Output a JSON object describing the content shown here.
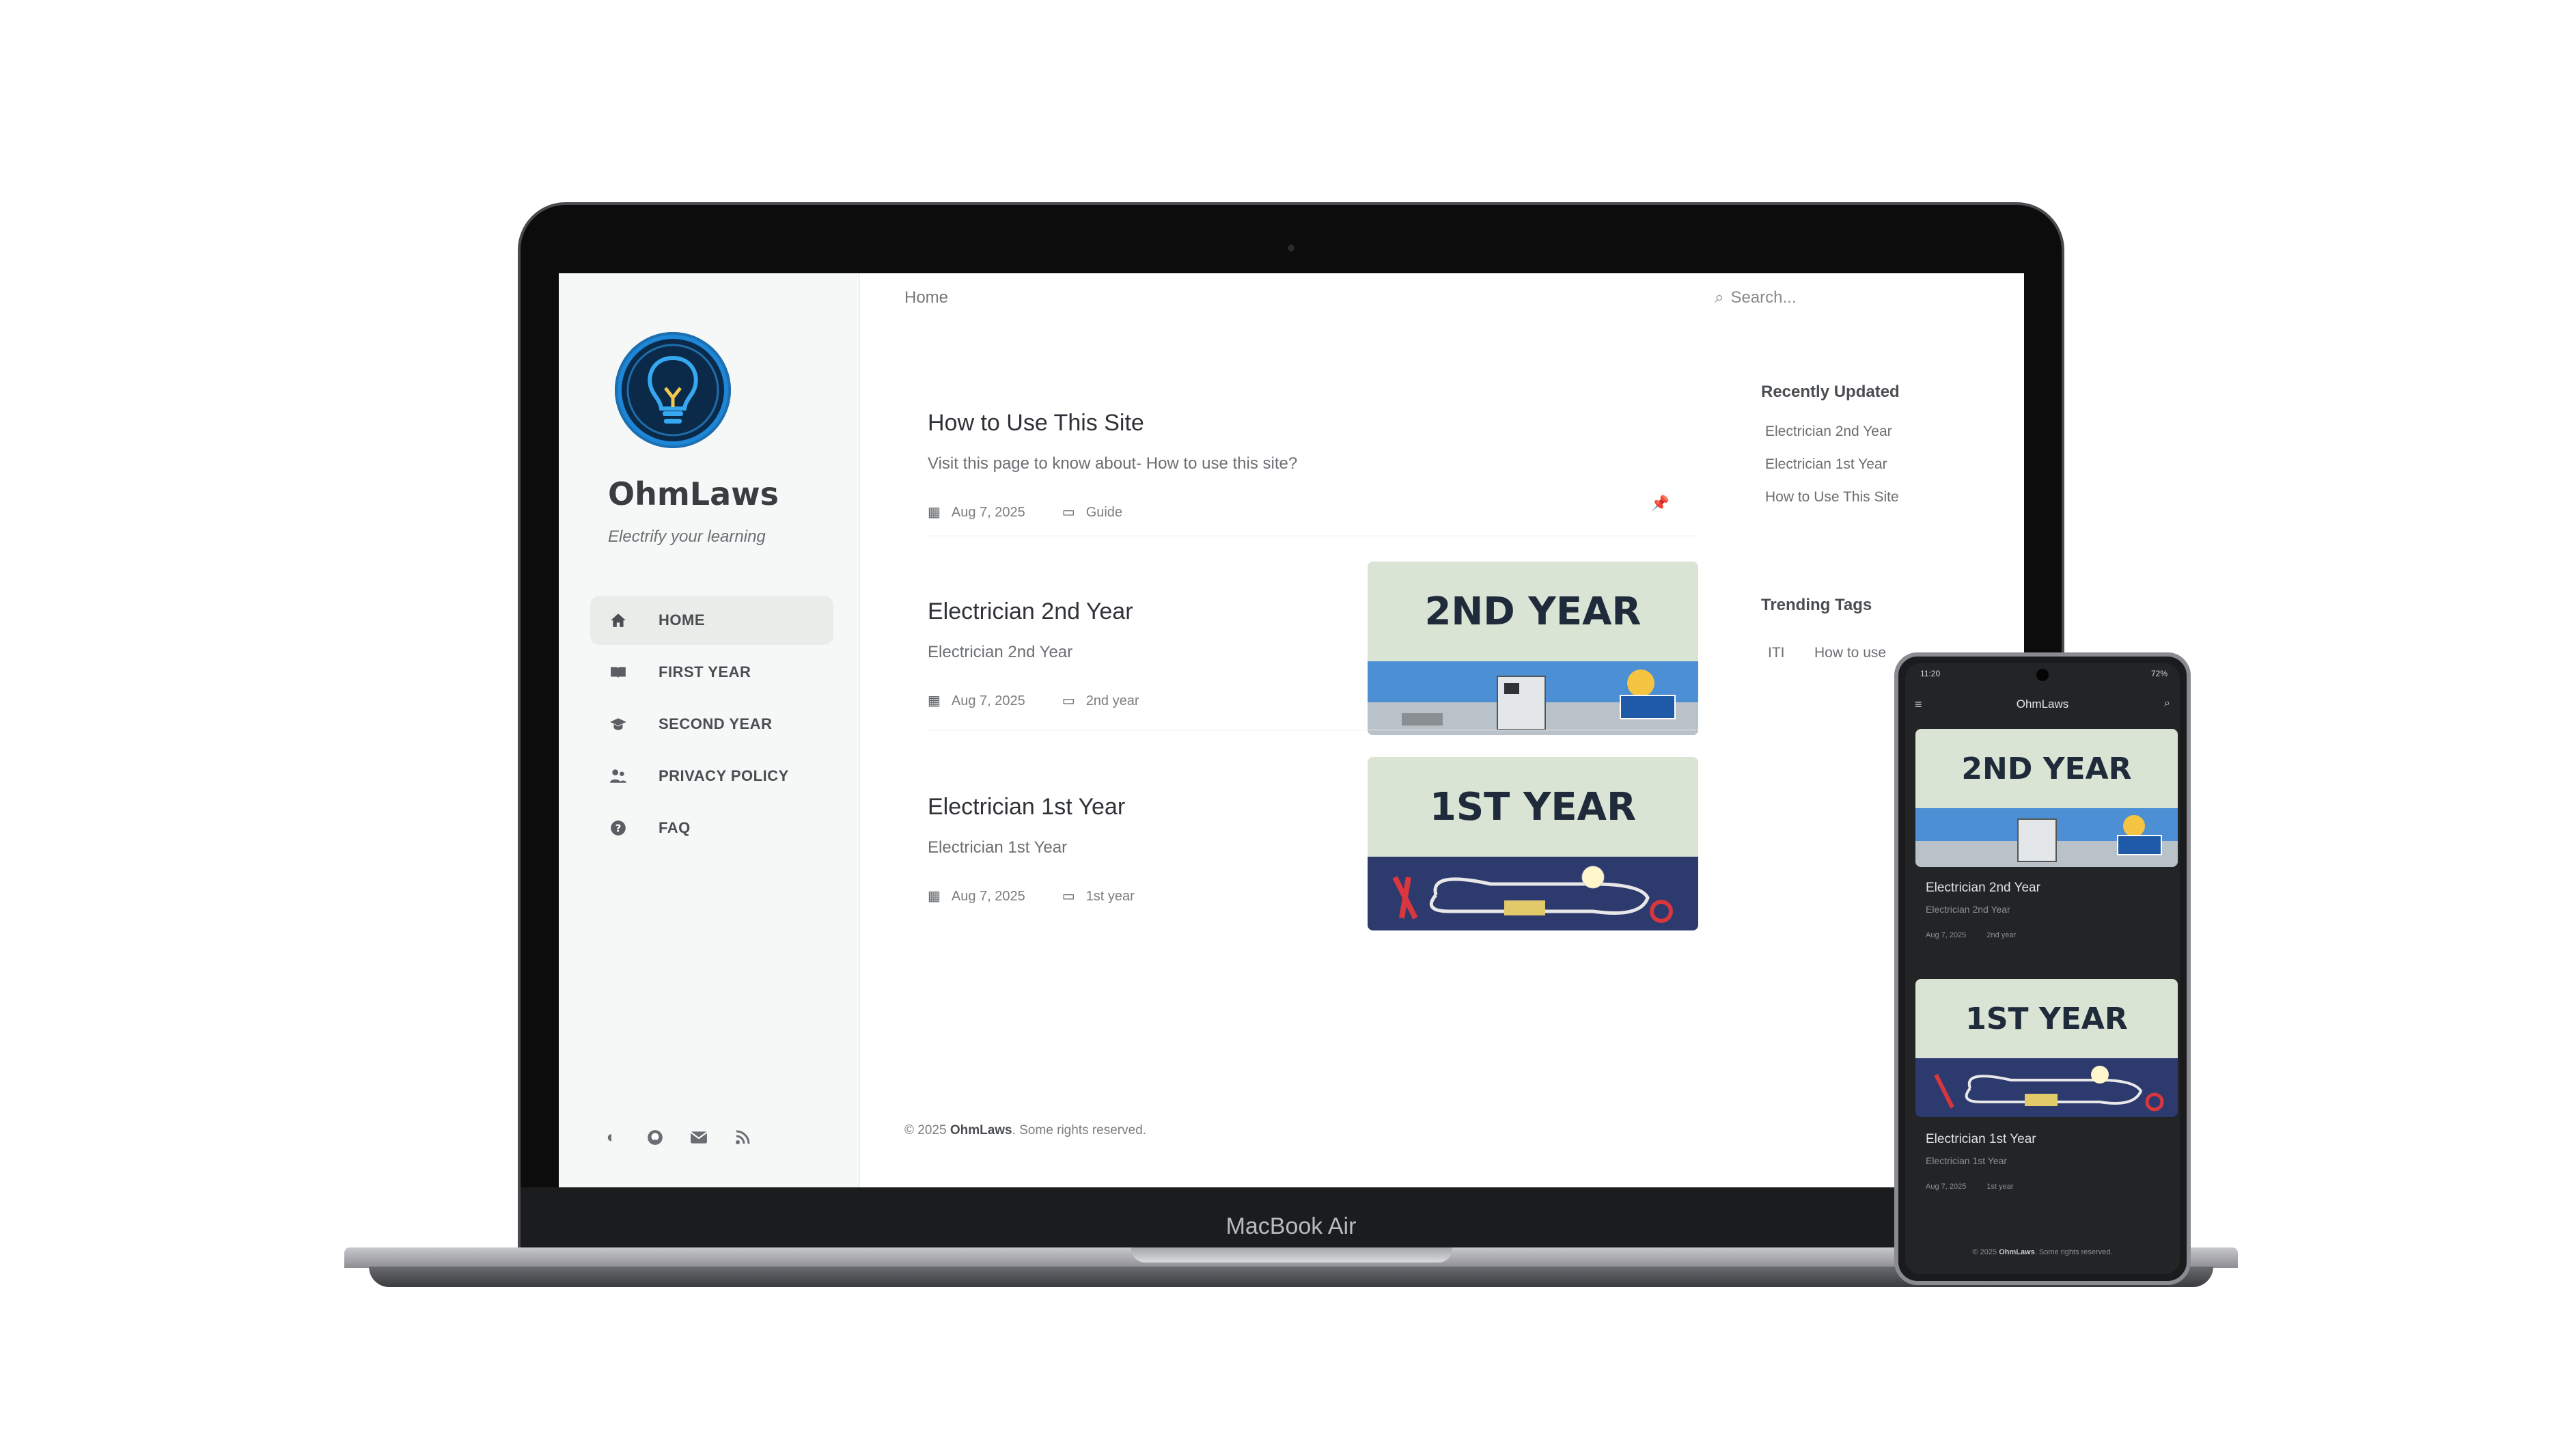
{
  "device_labels": {
    "laptop": "MacBook Air"
  },
  "site": {
    "title": "OhmLaws",
    "subtitle": "Electrify your learning"
  },
  "nav": [
    {
      "label": "HOME",
      "icon": "home-icon",
      "active": true
    },
    {
      "label": "FIRST YEAR",
      "icon": "book-icon",
      "active": false
    },
    {
      "label": "SECOND YEAR",
      "icon": "graduation-cap-icon",
      "active": false
    },
    {
      "label": "PRIVACY POLICY",
      "icon": "users-icon",
      "active": false
    },
    {
      "label": "FAQ",
      "icon": "question-circle-icon",
      "active": false
    }
  ],
  "breadcrumb": "Home",
  "search": {
    "placeholder": "Search..."
  },
  "posts": [
    {
      "title": "How to Use This Site",
      "description": "Visit this page to know about- How to use this site?",
      "date": "Aug 7, 2025",
      "category": "Guide",
      "pinned": true
    },
    {
      "title": "Electrician 2nd Year",
      "description": "Electrician 2nd Year",
      "date": "Aug 7, 2025",
      "category": "2nd year",
      "image_text": "2ND YEAR"
    },
    {
      "title": "Electrician 1st Year",
      "description": "Electrician 1st Year",
      "date": "Aug 7, 2025",
      "category": "1st year",
      "image_text": "1ST YEAR"
    }
  ],
  "recently_updated": {
    "heading": "Recently Updated",
    "items": [
      "Electrician 2nd Year",
      "Electrician 1st Year",
      "How to Use This Site"
    ]
  },
  "trending_tags": {
    "heading": "Trending Tags",
    "items": [
      "ITI",
      "How to use"
    ]
  },
  "footer": {
    "prefix": "© 2025 ",
    "brand": "OhmLaws",
    "suffix": ". Some rights reserved."
  },
  "phone": {
    "time": "11:20",
    "battery": "72%",
    "title": "OhmLaws",
    "cards": [
      {
        "image_text": "2ND YEAR",
        "title": "Electrician 2nd Year",
        "description": "Electrician 2nd Year",
        "date": "Aug 7, 2025",
        "category": "2nd year"
      },
      {
        "image_text": "1ST YEAR",
        "title": "Electrician 1st Year",
        "description": "Electrician 1st Year",
        "date": "Aug 7, 2025",
        "category": "1st year"
      }
    ],
    "footer": {
      "prefix": "© 2025 ",
      "brand": "OhmLaws",
      "suffix": ". Some rights reserved."
    }
  },
  "colors": {
    "accent_dark": "#1f2a3a",
    "thumb_bg": "#d9e4d5",
    "sidebar_bg": "#f6f8f8",
    "phone_bg": "#232426"
  }
}
